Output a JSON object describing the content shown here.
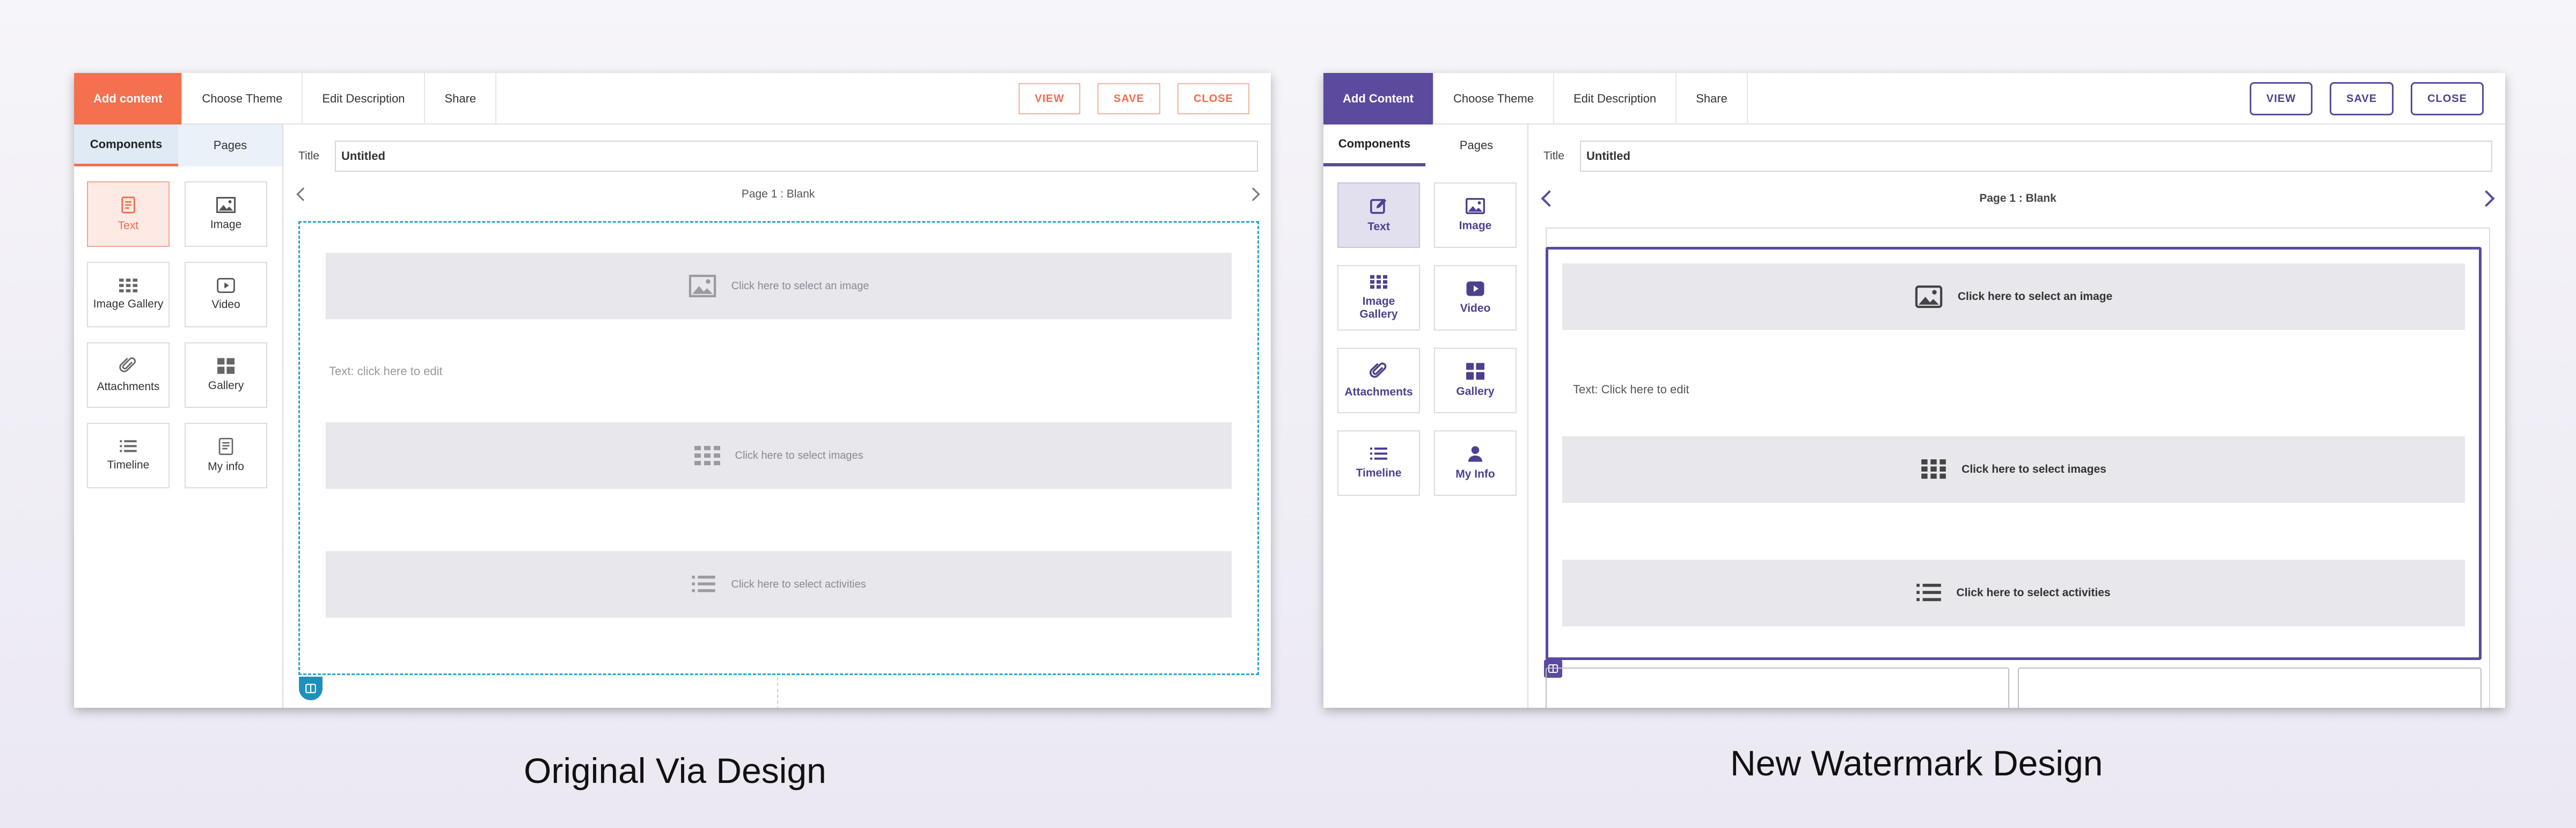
{
  "colors": {
    "original_accent": "#f4704f",
    "original_canvas_border": "#2aa3c9",
    "new_accent": "#5b4a9e"
  },
  "original": {
    "tabs": [
      "Add content",
      "Choose Theme",
      "Edit Description",
      "Share"
    ],
    "buttons": {
      "view": "VIEW",
      "save": "SAVE",
      "close": "CLOSE"
    },
    "side_tabs": [
      "Components",
      "Pages"
    ],
    "components": [
      {
        "label": "Text",
        "icon": "text-icon"
      },
      {
        "label": "Image",
        "icon": "image-icon"
      },
      {
        "label": "Image Gallery",
        "icon": "image-gallery-icon"
      },
      {
        "label": "Video",
        "icon": "video-icon"
      },
      {
        "label": "Attachments",
        "icon": "paperclip-icon"
      },
      {
        "label": "Gallery",
        "icon": "gallery-icon"
      },
      {
        "label": "Timeline",
        "icon": "timeline-icon"
      },
      {
        "label": "My info",
        "icon": "my-info-icon"
      }
    ],
    "title_label": "Title",
    "title_value": "Untitled",
    "page_label": "Page 1 : Blank",
    "image_block": "Click here to select an image",
    "text_block": "Text: click here to edit",
    "images_block": "Click here to select images",
    "activities_block": "Click here to select activities",
    "caption": "Original Via Design"
  },
  "new": {
    "tabs": [
      "Add Content",
      "Choose Theme",
      "Edit Description",
      "Share"
    ],
    "buttons": {
      "view": "VIEW",
      "save": "SAVE",
      "close": "CLOSE"
    },
    "side_tabs": [
      "Components",
      "Pages"
    ],
    "components": [
      {
        "label": "Text",
        "icon": "edit-icon"
      },
      {
        "label": "Image",
        "icon": "image-icon"
      },
      {
        "label": "Image Gallery",
        "icon": "image-gallery-icon"
      },
      {
        "label": "Video",
        "icon": "video-icon"
      },
      {
        "label": "Attachments",
        "icon": "paperclip-icon"
      },
      {
        "label": "Gallery",
        "icon": "gallery-icon"
      },
      {
        "label": "Timeline",
        "icon": "timeline-icon"
      },
      {
        "label": "My Info",
        "icon": "person-icon"
      }
    ],
    "title_label": "Title",
    "title_value": "Untitled",
    "page_label": "Page 1 : Blank",
    "image_block": "Click here to select an image",
    "text_block": "Text: Click here to edit",
    "images_block": "Click here to select images",
    "activities_block": "Click here to select activities",
    "caption": "New Watermark Design"
  }
}
